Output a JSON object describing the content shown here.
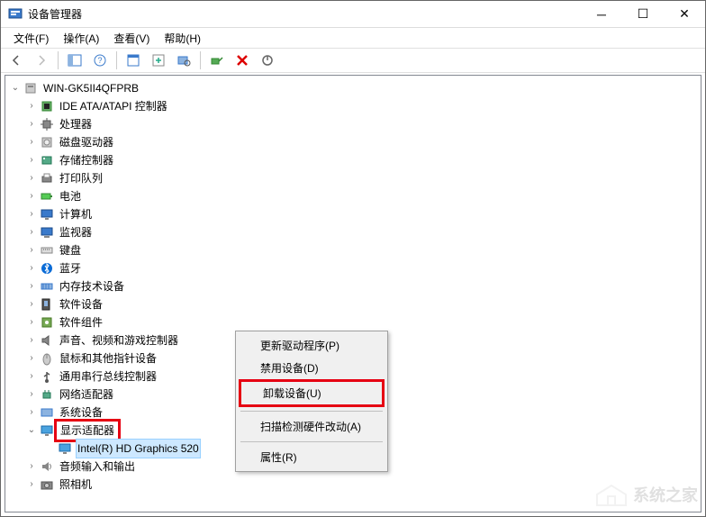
{
  "window": {
    "title": "设备管理器"
  },
  "menu": {
    "file": "文件(F)",
    "action": "操作(A)",
    "view": "查看(V)",
    "help": "帮助(H)"
  },
  "tree": {
    "root": "WIN-GK5II4QFPRB",
    "nodes": [
      {
        "label": "IDE ATA/ATAPI 控制器",
        "icon": "chip"
      },
      {
        "label": "处理器",
        "icon": "cpu"
      },
      {
        "label": "磁盘驱动器",
        "icon": "disk"
      },
      {
        "label": "存储控制器",
        "icon": "storage"
      },
      {
        "label": "打印队列",
        "icon": "printer"
      },
      {
        "label": "电池",
        "icon": "battery"
      },
      {
        "label": "计算机",
        "icon": "computer"
      },
      {
        "label": "监视器",
        "icon": "monitor"
      },
      {
        "label": "键盘",
        "icon": "keyboard"
      },
      {
        "label": "蓝牙",
        "icon": "bluetooth"
      },
      {
        "label": "内存技术设备",
        "icon": "memory"
      },
      {
        "label": "软件设备",
        "icon": "software"
      },
      {
        "label": "软件组件",
        "icon": "component"
      },
      {
        "label": "声音、视频和游戏控制器",
        "icon": "sound"
      },
      {
        "label": "鼠标和其他指针设备",
        "icon": "mouse"
      },
      {
        "label": "通用串行总线控制器",
        "icon": "usb"
      },
      {
        "label": "网络适配器",
        "icon": "network"
      },
      {
        "label": "系统设备",
        "icon": "system"
      },
      {
        "label": "显示适配器",
        "icon": "display",
        "expanded": true,
        "highlight": true,
        "children": [
          {
            "label": "Intel(R) HD Graphics 520",
            "icon": "display",
            "selected": true
          }
        ]
      },
      {
        "label": "音频输入和输出",
        "icon": "audio"
      },
      {
        "label": "照相机",
        "icon": "camera"
      }
    ]
  },
  "context_menu": {
    "update_driver": "更新驱动程序(P)",
    "disable_device": "禁用设备(D)",
    "uninstall_device": "卸载设备(U)",
    "scan_hardware": "扫描检测硬件改动(A)",
    "properties": "属性(R)"
  },
  "watermark": "系统之家"
}
